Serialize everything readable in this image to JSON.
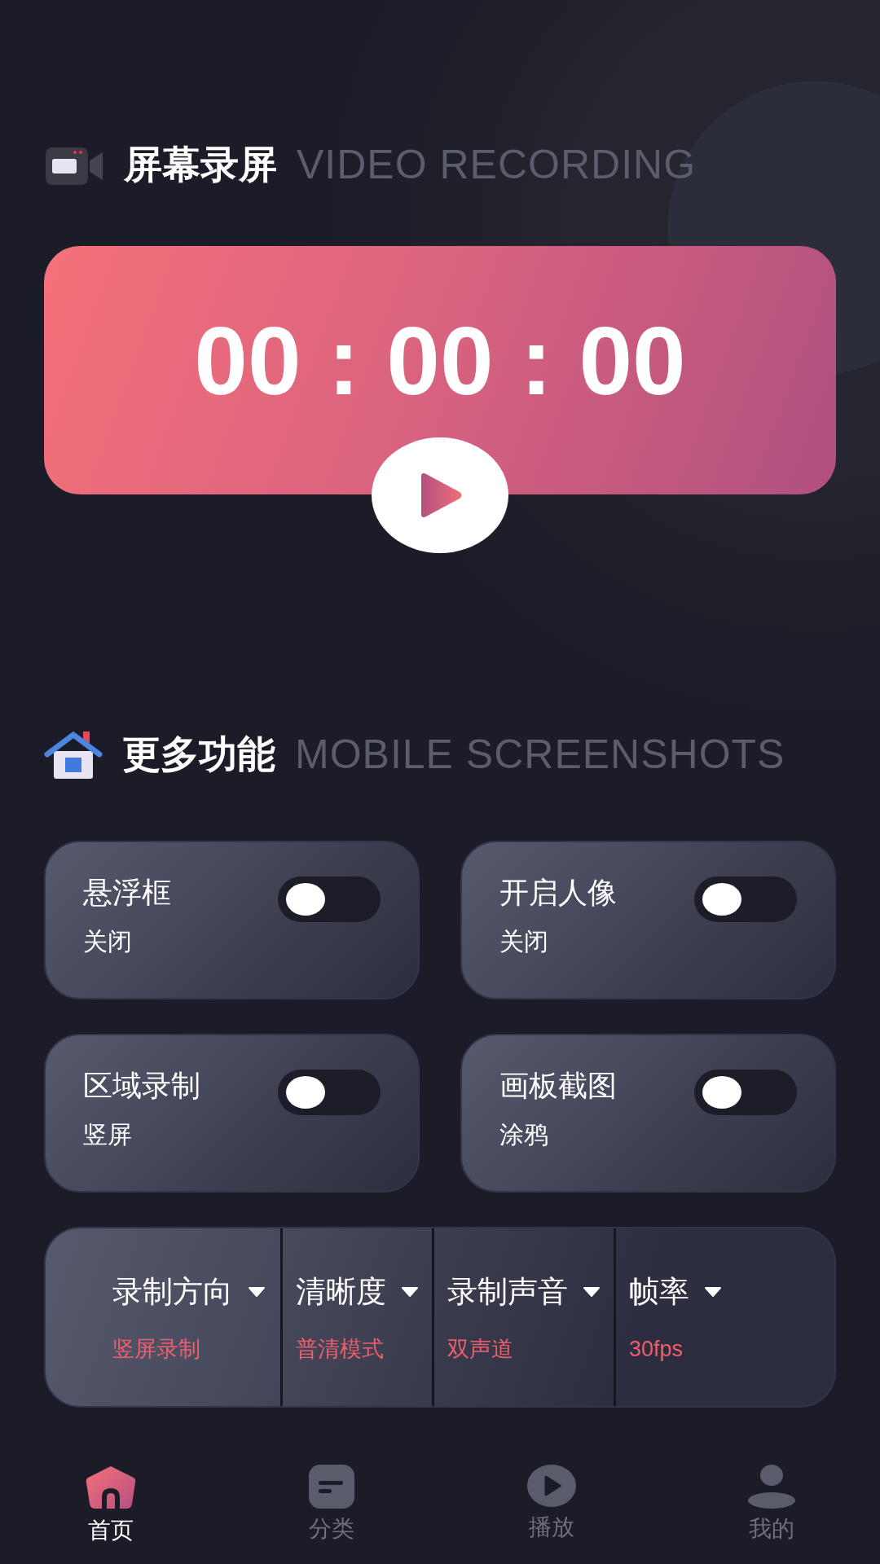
{
  "recording_header": {
    "title": "屏幕录屏",
    "subtitle": "VIDEO RECORDING"
  },
  "timer": {
    "time": "00 : 00 : 00"
  },
  "features_header": {
    "title": "更多功能",
    "subtitle": "MOBILE SCREENSHOTS"
  },
  "feature_cards": [
    {
      "label": "悬浮框",
      "status": "关闭",
      "on": false
    },
    {
      "label": "开启人像",
      "status": "关闭",
      "on": false
    },
    {
      "label": "区域录制",
      "status": "竖屏",
      "on": false
    },
    {
      "label": "画板截图",
      "status": "涂鸦",
      "on": false
    }
  ],
  "settings": [
    {
      "label": "录制方向",
      "value": "竖屏录制"
    },
    {
      "label": "清晰度",
      "value": "普清模式"
    },
    {
      "label": "录制声音",
      "value": "双声道"
    },
    {
      "label": "帧率",
      "value": "30fps"
    }
  ],
  "bottom_nav": [
    {
      "kind": "home",
      "label": "首页",
      "selected": true
    },
    {
      "kind": "category",
      "label": "分类",
      "selected": false
    },
    {
      "kind": "play",
      "label": "播放",
      "selected": false
    },
    {
      "kind": "profile",
      "label": "我的",
      "selected": false
    }
  ]
}
